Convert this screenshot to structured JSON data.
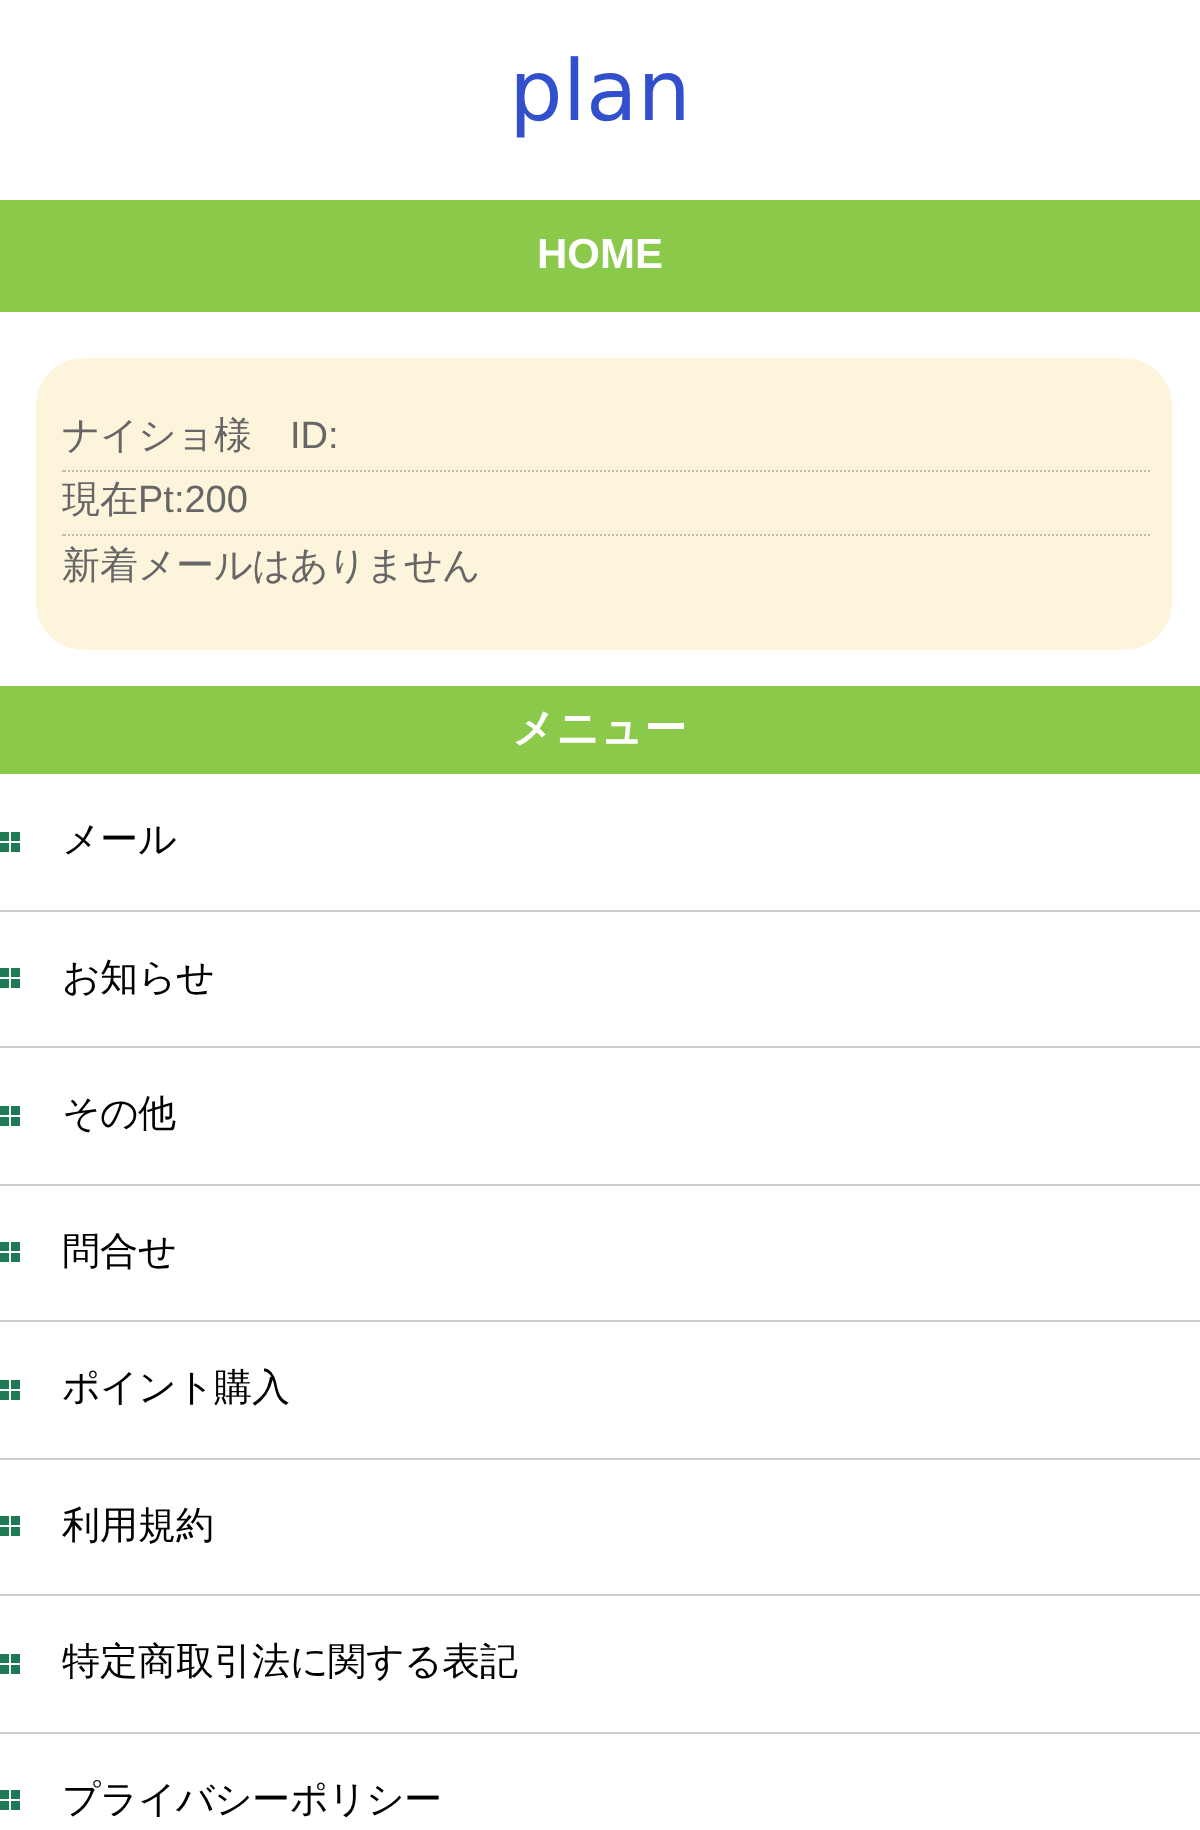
{
  "header": {
    "logo": "plan"
  },
  "home_bar": {
    "title": "HOME"
  },
  "user_card": {
    "lines": [
      "ナイショ様　ID:",
      "現在Pt:200",
      "新着メールはありません"
    ]
  },
  "menu_bar": {
    "title": "メニュー"
  },
  "menu": {
    "items": [
      {
        "label": "メール"
      },
      {
        "label": "お知らせ"
      },
      {
        "label": "その他"
      },
      {
        "label": "問合せ"
      },
      {
        "label": "ポイント購入"
      },
      {
        "label": "利用規約"
      },
      {
        "label": "特定商取引法に関する表記"
      },
      {
        "label": "プライバシーポリシー"
      }
    ]
  }
}
